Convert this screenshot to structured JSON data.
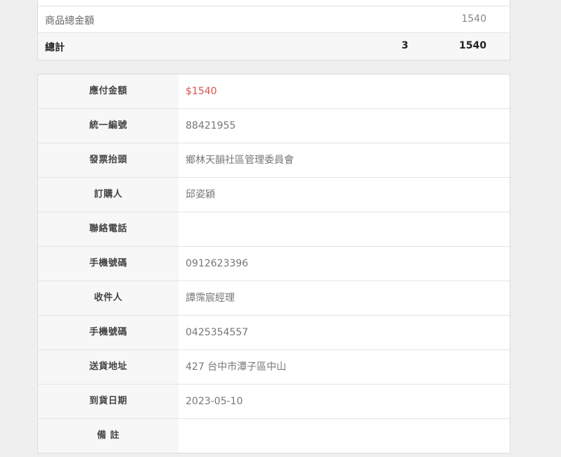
{
  "summary": {
    "subtotal_label": "商品總金額",
    "subtotal_amount": "1540",
    "total_label": "總計",
    "total_qty": "3",
    "total_amount": "1540"
  },
  "details": {
    "rows": [
      {
        "label": "應付金額",
        "value": "$1540"
      },
      {
        "label": "統一編號",
        "value": "88421955"
      },
      {
        "label": "發票抬頭",
        "value": "鄉林天韻社區管理委員會"
      },
      {
        "label": "訂購人",
        "value": "邱姿穎"
      },
      {
        "label": "聯絡電話",
        "value": ""
      },
      {
        "label": "手機號碼",
        "value": "0912623396"
      },
      {
        "label": "收件人",
        "value": "譚霈宸經理"
      },
      {
        "label": "手機號碼",
        "value": "0425354557"
      },
      {
        "label": "送貨地址",
        "value": "427 台中市潭子區中山"
      },
      {
        "label": "到貨日期",
        "value": "2023-05-10"
      },
      {
        "label": "備 註",
        "value": ""
      }
    ]
  },
  "colors": {
    "price": "#d9534f",
    "page_bg": "#efefef"
  }
}
